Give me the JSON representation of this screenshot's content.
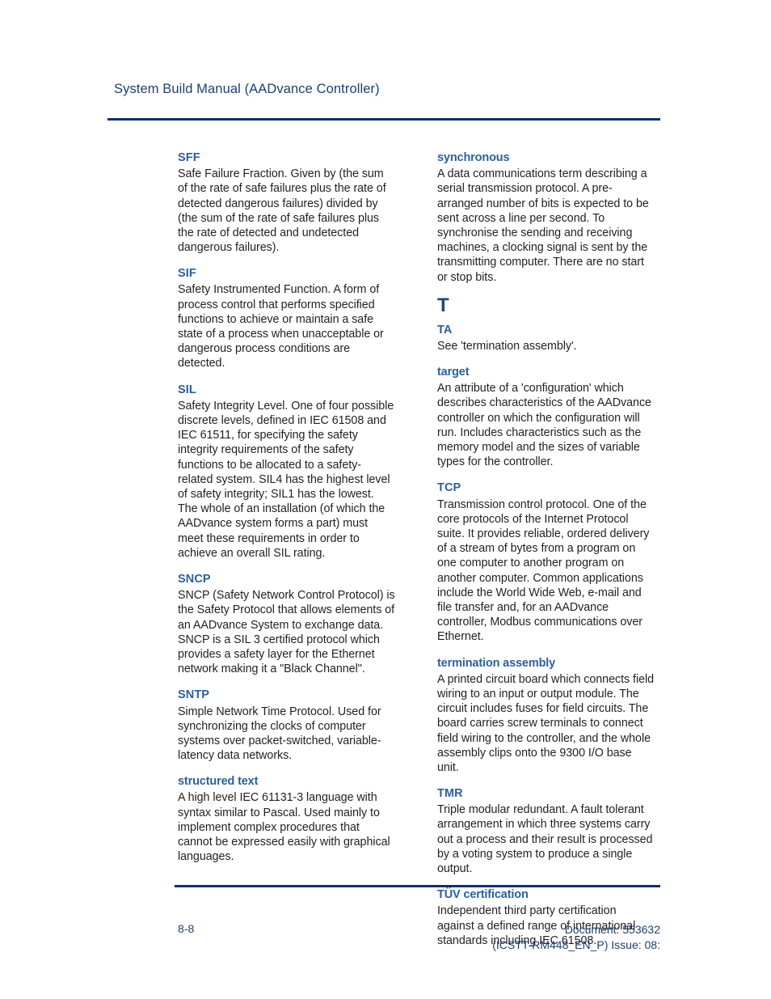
{
  "header": {
    "title": "System Build Manual  (AADvance Controller)"
  },
  "colors": {
    "rule": "#0b3160",
    "term_heading": "#2d6099",
    "letter_heading": "#1c4a80",
    "header_text": "#1c3f6e",
    "body_text": "#231f20"
  },
  "glossary": {
    "left_column": [
      {
        "term": "SFF",
        "style": "acronym",
        "definition": "Safe Failure Fraction. Given by (the sum of the rate of safe failures plus the rate of detected dangerous failures) divided by (the sum of the rate of safe failures plus the rate of detected and undetected dangerous failures)."
      },
      {
        "term": "SIF",
        "style": "acronym",
        "definition": "Safety Instrumented Function. A form of process control that performs specified functions to achieve or maintain a safe state of a process when unacceptable or dangerous process conditions are detected."
      },
      {
        "term": "SIL",
        "style": "acronym",
        "definition": "Safety Integrity Level. One of four possible discrete levels, defined in IEC 61508 and IEC 61511, for specifying the safety integrity requirements of the safety functions to be allocated to a safety-related system. SIL4 has the highest level of safety integrity; SIL1 has the lowest.",
        "definition2": "The whole of an installation (of which the AADvance system forms a part) must meet these requirements in order to achieve an overall SIL rating."
      },
      {
        "term": "SNCP",
        "style": "acronym",
        "definition": "SNCP (Safety Network Control Protocol) is the Safety Protocol that allows elements of an AADvance System to exchange data. SNCP is a SIL 3 certified protocol which provides a safety layer for the Ethernet network making it a \"Black Channel\"."
      },
      {
        "term": "SNTP",
        "style": "acronym",
        "definition": "Simple Network Time Protocol. Used for synchronizing the clocks of computer systems over packet-switched, variable-latency data networks."
      },
      {
        "term": "structured text",
        "style": "lowercase",
        "definition": "A high level IEC 61131-3 language with syntax similar to Pascal. Used mainly to implement complex procedures that cannot be expressed easily with graphical languages."
      }
    ],
    "right_column": [
      {
        "term": "synchronous",
        "style": "lowercase",
        "definition": "A data communications term describing a serial transmission protocol. A pre-arranged number of bits is expected to be sent across a line per second. To synchronise the sending and receiving machines, a clocking signal is sent by the transmitting computer. There are no start or stop bits."
      }
    ],
    "letter_section": "T",
    "right_column_after_letter": [
      {
        "term": "TA",
        "style": "acronym",
        "definition": "See 'termination assembly'."
      },
      {
        "term": "target",
        "style": "lowercase",
        "definition": "An attribute of a 'configuration' which describes characteristics of the AADvance controller on which the configuration will run. Includes characteristics such as the memory model and the sizes of variable types for the controller."
      },
      {
        "term": "TCP",
        "style": "acronym",
        "definition": "Transmission control protocol. One of the core protocols of the Internet Protocol suite. It provides reliable, ordered delivery of a stream of bytes from a program on one computer to another program on another computer. Common applications include the World Wide Web, e-mail and file transfer and, for an AADvance controller, Modbus communications over Ethernet."
      },
      {
        "term": "termination assembly",
        "style": "lowercase",
        "definition": "A printed circuit board which connects field wiring to an input or output module. The circuit includes fuses for field circuits. The board carries screw terminals to connect field wiring to the controller, and the whole assembly clips onto the 9300 I/O base unit."
      },
      {
        "term": "TMR",
        "style": "acronym",
        "definition": "Triple modular redundant. A fault tolerant arrangement in which three systems carry out a process and their result is processed by a voting system to produce a single output."
      },
      {
        "term": "TÜV certification",
        "style": "lowercase",
        "definition": "Independent third party certification against a defined range of international standards including IEC 61508."
      }
    ]
  },
  "footer": {
    "page_number": "8-8",
    "document_line1": "Document: 553632",
    "document_line2": "(ICSTT-RM448_EN_P) Issue: 08:"
  }
}
